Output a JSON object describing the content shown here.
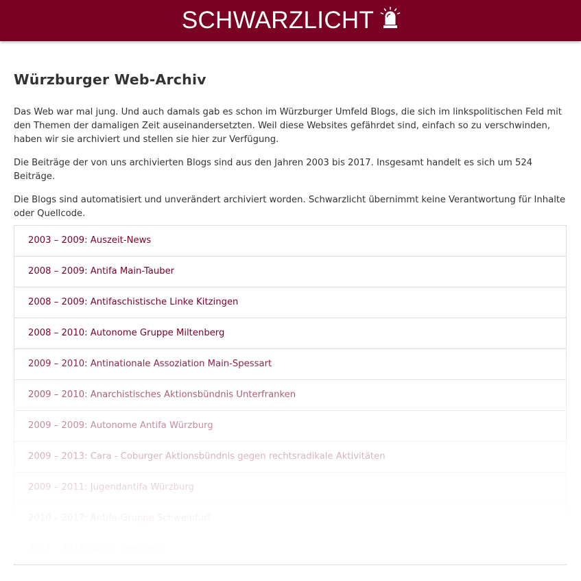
{
  "header": {
    "brand_text": "SCHWARZLICHT",
    "brand_icon": "siren-light-icon",
    "background_color": "#7a0024"
  },
  "main": {
    "title": "Würzburger Web-Archiv",
    "paragraphs": [
      "Das Web war mal jung. Und auch damals gab es schon im Würzburger Umfeld Blogs, die sich im linkspolitischen Feld mit den Themen der damaligen Zeit auseinandersetzten. Weil diese Websites gefährdet sind, einfach so zu verschwinden, haben wir sie archiviert und stellen sie hier zur Verfügung.",
      "Die Beiträge der von uns archivierten Blogs sind aus den Jahren 2003 bis 2017. Insgesamt handelt es sich um 524 Beiträge.",
      "Die Blogs sind automatisiert und unverändert archiviert worden. Schwarzlicht übernimmt keine Verantwortung für Inhalte oder Quellcode."
    ],
    "archive_list": [
      "2003 – 2009: Auszeit-News",
      "2008 – 2009: Antifa Main-Tauber",
      "2008 – 2009: Antifaschistische Linke Kitzingen",
      "2008 – 2010: Autonome Gruppe Miltenberg",
      "2009 – 2010: Antinationale Assoziation Main-Spessart",
      "2009 – 2010: Anarchistisches Aktionsbündnis Unterfranken",
      "2009 – 2009: Autonome Antifa Würzburg",
      "2009 – 2013: Cara - Coburger Aktionsbündnis gegen rechtsradikale Aktivitäten",
      "2009 – 2011: Jugendantifa Würzburg",
      "2010 – 2017: Antifa-Gruppe Schweinfurt",
      "2011 – 2016: Antifa Bamberg"
    ],
    "link_color": "#7a0024"
  }
}
